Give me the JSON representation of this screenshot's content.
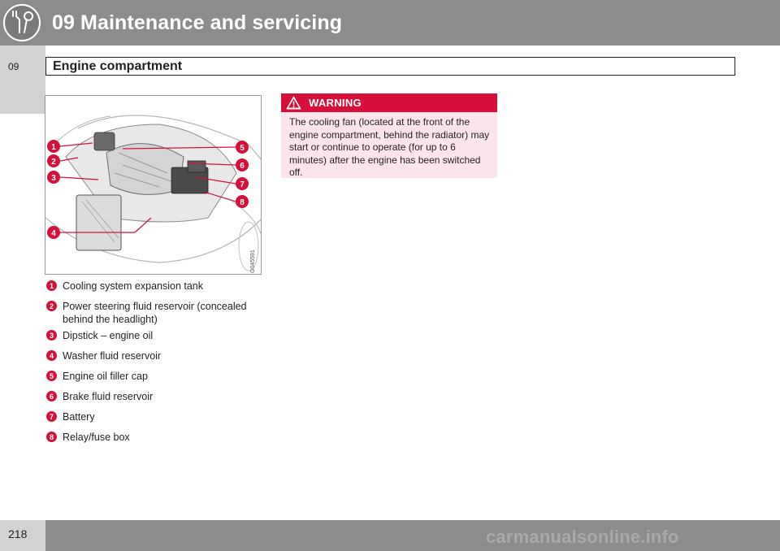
{
  "header": {
    "chapter_number": "09",
    "chapter_title": "09 Maintenance and servicing",
    "icon": "wrench-screwdriver-icon"
  },
  "section": {
    "title": "Engine compartment"
  },
  "illustration": {
    "code": "G045591",
    "callouts": [
      "1",
      "2",
      "3",
      "4",
      "5",
      "6",
      "7",
      "8"
    ]
  },
  "legend": {
    "items": [
      {
        "num": "1",
        "label": "Cooling system expansion tank"
      },
      {
        "num": "2",
        "label": "Power steering fluid reservoir (concealed behind the headlight)"
      },
      {
        "num": "3",
        "label": "Dipstick – engine oil"
      },
      {
        "num": "4",
        "label": "Washer fluid reservoir"
      },
      {
        "num": "5",
        "label": "Engine oil filler cap"
      },
      {
        "num": "6",
        "label": "Brake fluid reservoir"
      },
      {
        "num": "7",
        "label": "Battery"
      },
      {
        "num": "8",
        "label": "Relay/fuse box"
      }
    ]
  },
  "warning": {
    "title": "WARNING",
    "icon": "warning-triangle-icon",
    "text": "The cooling fan (located at the front of the engine compartment, behind the radiator) may start or continue to operate (for up to 6 minutes) after the engine has been switched off."
  },
  "footer": {
    "page_number": "218",
    "watermark": "carmanualsonline.info"
  },
  "colors": {
    "header_gray": "#8c8c8e",
    "tab_gray": "#d2d2d4",
    "accent_red": "#d4103b",
    "warning_bg": "#fbe4ea"
  }
}
